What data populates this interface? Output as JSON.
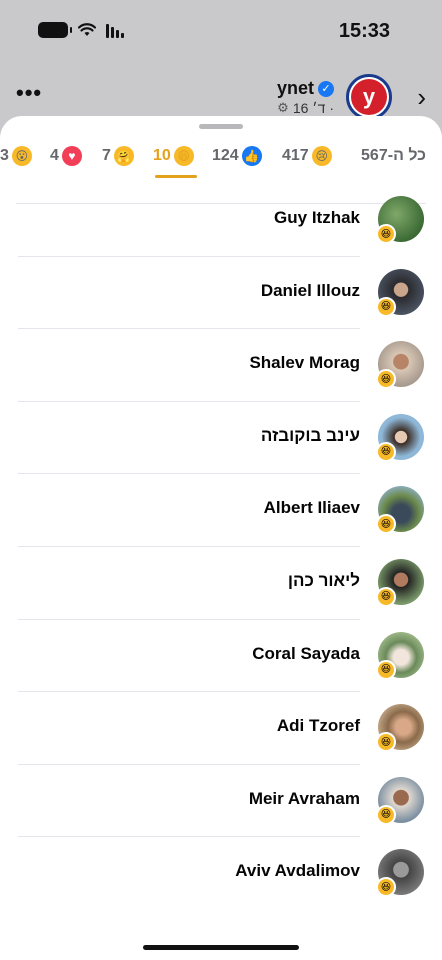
{
  "status_bar": {
    "time": "15:33"
  },
  "post_header": {
    "page_name": "ynet",
    "post_time": "16 ד׳ ·",
    "avatar_letter": "y",
    "more_label": "•••",
    "back_label": "›"
  },
  "tabs": [
    {
      "label": "כל ה-567",
      "emoji": null,
      "active": false
    },
    {
      "count": "417",
      "emoji": "sad-emoji",
      "active": false
    },
    {
      "count": "124",
      "emoji": "like-emoji",
      "active": false
    },
    {
      "count": "10",
      "emoji": "haha-emoji",
      "active": true
    },
    {
      "count": "7",
      "emoji": "care-emoji",
      "active": false
    },
    {
      "count": "4",
      "emoji": "love-emoji",
      "active": false
    },
    {
      "count": "3",
      "emoji": "wow-emoji",
      "active": false
    }
  ],
  "reactors": [
    {
      "name": "Guy Itzhak",
      "reaction": "haha"
    },
    {
      "name": "Daniel Illouz",
      "reaction": "haha"
    },
    {
      "name": "Shalev Morag",
      "reaction": "haha"
    },
    {
      "name": "עינב בוקובזה",
      "reaction": "haha"
    },
    {
      "name": "Albert Iliaev",
      "reaction": "haha"
    },
    {
      "name": "ליאור כהן",
      "reaction": "haha"
    },
    {
      "name": "Coral Sayada",
      "reaction": "haha"
    },
    {
      "name": "Adi Tzoref",
      "reaction": "haha"
    },
    {
      "name": "Meir Avraham",
      "reaction": "haha"
    },
    {
      "name": "Aviv Avdalimov",
      "reaction": "haha"
    }
  ],
  "colors": {
    "accent": "#e4a11b",
    "like_blue": "#1877f2",
    "love_red": "#f33e58",
    "emoji_yellow": "#f7b928"
  }
}
